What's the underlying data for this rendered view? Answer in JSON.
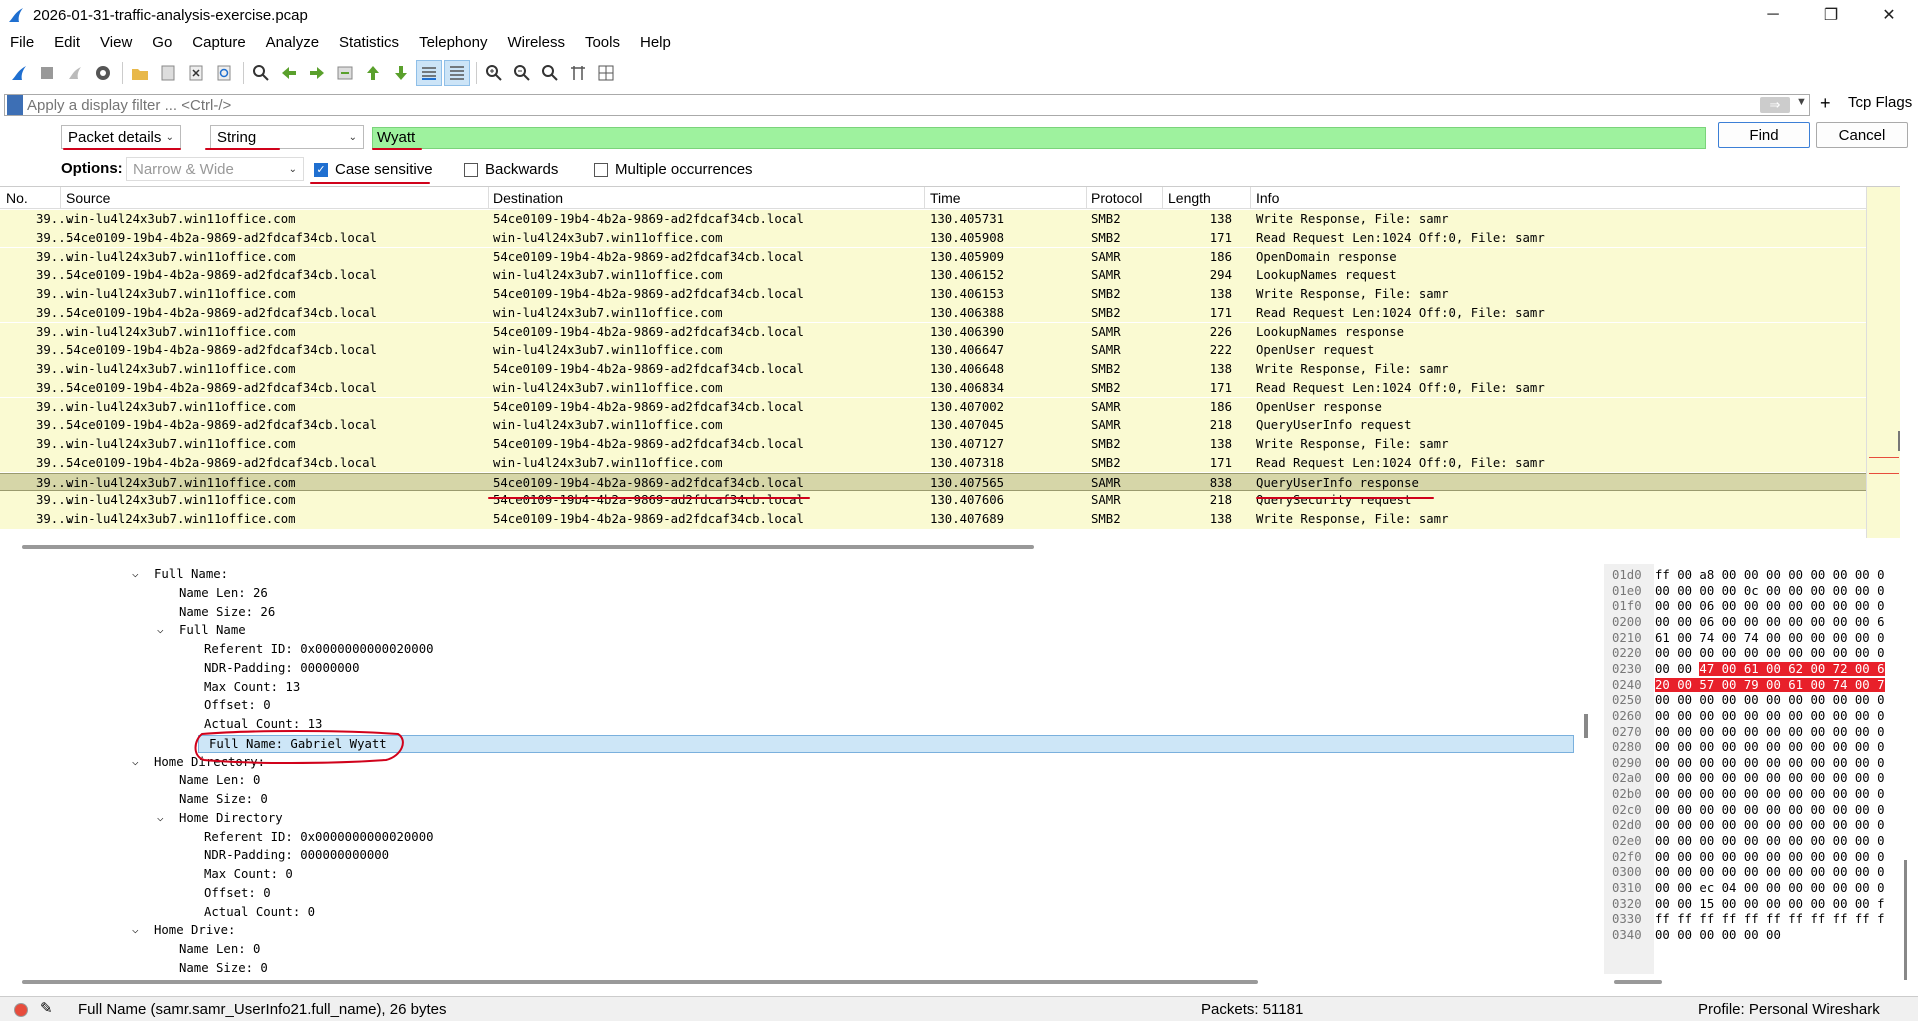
{
  "window": {
    "title": "2026-01-31-traffic-analysis-exercise.pcap",
    "minimize": "─",
    "maximize": "❐",
    "close": "✕"
  },
  "menu": [
    "File",
    "Edit",
    "View",
    "Go",
    "Capture",
    "Analyze",
    "Statistics",
    "Telephony",
    "Wireless",
    "Tools",
    "Help"
  ],
  "filter": {
    "placeholder": "Apply a display filter ... <Ctrl-/>",
    "apply_arrow": "⇒",
    "plus": "+",
    "tcp_flags": "Tcp Flags"
  },
  "find": {
    "search_in": "Packet details",
    "search_type": "String",
    "query": "Wyatt",
    "find_label": "Find",
    "cancel_label": "Cancel",
    "options_label": "Options:",
    "encoding": "Narrow & Wide",
    "case_sensitive_label": "Case sensitive",
    "case_sensitive_checked": true,
    "backwards_label": "Backwards",
    "multiple_label": "Multiple occurrences"
  },
  "packet_list": {
    "columns": [
      "No.",
      "Source",
      "Destination",
      "Time",
      "Protocol",
      "Length",
      "Info"
    ],
    "rows": [
      {
        "no": "39...",
        "source": "win-lu4l24x3ub7.win11office.com",
        "destination": "54ce0109-19b4-4b2a-9869-ad2fdcaf34cb.local",
        "time": "130.405731",
        "protocol": "SMB2",
        "length": "138",
        "info": "Write Response, File: samr"
      },
      {
        "no": "39...",
        "source": "54ce0109-19b4-4b2a-9869-ad2fdcaf34cb.local",
        "destination": "win-lu4l24x3ub7.win11office.com",
        "time": "130.405908",
        "protocol": "SMB2",
        "length": "171",
        "info": "Read Request Len:1024 Off:0, File: samr"
      },
      {
        "no": "39...",
        "source": "win-lu4l24x3ub7.win11office.com",
        "destination": "54ce0109-19b4-4b2a-9869-ad2fdcaf34cb.local",
        "time": "130.405909",
        "protocol": "SAMR",
        "length": "186",
        "info": "OpenDomain response"
      },
      {
        "no": "39...",
        "source": "54ce0109-19b4-4b2a-9869-ad2fdcaf34cb.local",
        "destination": "win-lu4l24x3ub7.win11office.com",
        "time": "130.406152",
        "protocol": "SAMR",
        "length": "294",
        "info": "LookupNames request"
      },
      {
        "no": "39...",
        "source": "win-lu4l24x3ub7.win11office.com",
        "destination": "54ce0109-19b4-4b2a-9869-ad2fdcaf34cb.local",
        "time": "130.406153",
        "protocol": "SMB2",
        "length": "138",
        "info": "Write Response, File: samr"
      },
      {
        "no": "39...",
        "source": "54ce0109-19b4-4b2a-9869-ad2fdcaf34cb.local",
        "destination": "win-lu4l24x3ub7.win11office.com",
        "time": "130.406388",
        "protocol": "SMB2",
        "length": "171",
        "info": "Read Request Len:1024 Off:0, File: samr"
      },
      {
        "no": "39...",
        "source": "win-lu4l24x3ub7.win11office.com",
        "destination": "54ce0109-19b4-4b2a-9869-ad2fdcaf34cb.local",
        "time": "130.406390",
        "protocol": "SAMR",
        "length": "226",
        "info": "LookupNames response"
      },
      {
        "no": "39...",
        "source": "54ce0109-19b4-4b2a-9869-ad2fdcaf34cb.local",
        "destination": "win-lu4l24x3ub7.win11office.com",
        "time": "130.406647",
        "protocol": "SAMR",
        "length": "222",
        "info": "OpenUser request"
      },
      {
        "no": "39...",
        "source": "win-lu4l24x3ub7.win11office.com",
        "destination": "54ce0109-19b4-4b2a-9869-ad2fdcaf34cb.local",
        "time": "130.406648",
        "protocol": "SMB2",
        "length": "138",
        "info": "Write Response, File: samr"
      },
      {
        "no": "39...",
        "source": "54ce0109-19b4-4b2a-9869-ad2fdcaf34cb.local",
        "destination": "win-lu4l24x3ub7.win11office.com",
        "time": "130.406834",
        "protocol": "SMB2",
        "length": "171",
        "info": "Read Request Len:1024 Off:0, File: samr"
      },
      {
        "no": "39...",
        "source": "win-lu4l24x3ub7.win11office.com",
        "destination": "54ce0109-19b4-4b2a-9869-ad2fdcaf34cb.local",
        "time": "130.407002",
        "protocol": "SAMR",
        "length": "186",
        "info": "OpenUser response"
      },
      {
        "no": "39...",
        "source": "54ce0109-19b4-4b2a-9869-ad2fdcaf34cb.local",
        "destination": "win-lu4l24x3ub7.win11office.com",
        "time": "130.407045",
        "protocol": "SAMR",
        "length": "218",
        "info": "QueryUserInfo request"
      },
      {
        "no": "39...",
        "source": "win-lu4l24x3ub7.win11office.com",
        "destination": "54ce0109-19b4-4b2a-9869-ad2fdcaf34cb.local",
        "time": "130.407127",
        "protocol": "SMB2",
        "length": "138",
        "info": "Write Response, File: samr"
      },
      {
        "no": "39...",
        "source": "54ce0109-19b4-4b2a-9869-ad2fdcaf34cb.local",
        "destination": "win-lu4l24x3ub7.win11office.com",
        "time": "130.407318",
        "protocol": "SMB2",
        "length": "171",
        "info": "Read Request Len:1024 Off:0, File: samr"
      },
      {
        "no": "39...",
        "source": "win-lu4l24x3ub7.win11office.com",
        "destination": "54ce0109-19b4-4b2a-9869-ad2fdcaf34cb.local",
        "time": "130.407565",
        "protocol": "SAMR",
        "length": "838",
        "info": "QueryUserInfo response",
        "selected": true
      },
      {
        "no": "39...",
        "source": "win-lu4l24x3ub7.win11office.com",
        "destination": "54ce0109-19b4-4b2a-9869-ad2fdcaf34cb.local",
        "time": "130.407606",
        "protocol": "SAMR",
        "length": "218",
        "info": "QuerySecurity request"
      },
      {
        "no": "39...",
        "source": "win-lu4l24x3ub7.win11office.com",
        "destination": "54ce0109-19b4-4b2a-9869-ad2fdcaf34cb.local",
        "time": "130.407689",
        "protocol": "SMB2",
        "length": "138",
        "info": "Write Response, File: samr"
      }
    ]
  },
  "details": [
    {
      "indent": 0,
      "arrow": "down",
      "text": "Full Name:"
    },
    {
      "indent": 1,
      "arrow": "",
      "text": "Name Len: 26"
    },
    {
      "indent": 1,
      "arrow": "",
      "text": "Name Size: 26"
    },
    {
      "indent": 1,
      "arrow": "down",
      "text": "Full Name"
    },
    {
      "indent": 2,
      "arrow": "",
      "text": "Referent ID: 0x0000000000020000"
    },
    {
      "indent": 2,
      "arrow": "",
      "text": "NDR-Padding: 00000000"
    },
    {
      "indent": 2,
      "arrow": "",
      "text": "Max Count: 13"
    },
    {
      "indent": 2,
      "arrow": "",
      "text": "Offset: 0"
    },
    {
      "indent": 2,
      "arrow": "",
      "text": "Actual Count: 13"
    },
    {
      "indent": 2,
      "arrow": "",
      "text": "Full Name: Gabriel Wyatt",
      "selected": true
    },
    {
      "indent": 0,
      "arrow": "down",
      "text": "Home Directory:"
    },
    {
      "indent": 1,
      "arrow": "",
      "text": "Name Len: 0"
    },
    {
      "indent": 1,
      "arrow": "",
      "text": "Name Size: 0"
    },
    {
      "indent": 1,
      "arrow": "down",
      "text": "Home Directory"
    },
    {
      "indent": 2,
      "arrow": "",
      "text": "Referent ID: 0x0000000000020000"
    },
    {
      "indent": 2,
      "arrow": "",
      "text": "NDR-Padding: 000000000000"
    },
    {
      "indent": 2,
      "arrow": "",
      "text": "Max Count: 0"
    },
    {
      "indent": 2,
      "arrow": "",
      "text": "Offset: 0"
    },
    {
      "indent": 2,
      "arrow": "",
      "text": "Actual Count: 0"
    },
    {
      "indent": 0,
      "arrow": "down",
      "text": "Home Drive:"
    },
    {
      "indent": 1,
      "arrow": "",
      "text": "Name Len: 0"
    },
    {
      "indent": 1,
      "arrow": "",
      "text": "Name Size: 0"
    }
  ],
  "hex": [
    {
      "offset": "01d0",
      "bytes": "ff 00 a8 00 00 00 00 00  00 00 0"
    },
    {
      "offset": "01e0",
      "bytes": "00 00 00 00 0c 00 00 00  00 00 0"
    },
    {
      "offset": "01f0",
      "bytes": "00 00 06 00 00 00 00 00  00 00 0"
    },
    {
      "offset": "0200",
      "bytes": "00 00 06 00 00 00 00 00  00 00 6"
    },
    {
      "offset": "0210",
      "bytes": "61 00 74 00 74 00 00 00  00 00 0"
    },
    {
      "offset": "0220",
      "bytes": "00 00 00 00 00 00 00 00  00 00 0"
    },
    {
      "offset": "0230",
      "bytes_plain": "00 00 ",
      "bytes_hl": "47 00 61 00 62 00  72 00 6"
    },
    {
      "offset": "0240",
      "bytes_plain": "",
      "bytes_hl": "20 00 57 00 79 00 61 00  74 00 7"
    },
    {
      "offset": "0250",
      "bytes": "00 00 00 00 00 00 00 00  00 00 0"
    },
    {
      "offset": "0260",
      "bytes": "00 00 00 00 00 00 00 00  00 00 0"
    },
    {
      "offset": "0270",
      "bytes": "00 00 00 00 00 00 00 00  00 00 0"
    },
    {
      "offset": "0280",
      "bytes": "00 00 00 00 00 00 00 00  00 00 0"
    },
    {
      "offset": "0290",
      "bytes": "00 00 00 00 00 00 00 00  00 00 0"
    },
    {
      "offset": "02a0",
      "bytes": "00 00 00 00 00 00 00 00  00 00 0"
    },
    {
      "offset": "02b0",
      "bytes": "00 00 00 00 00 00 00 00  00 00 0"
    },
    {
      "offset": "02c0",
      "bytes": "00 00 00 00 00 00 00 00  00 00 0"
    },
    {
      "offset": "02d0",
      "bytes": "00 00 00 00 00 00 00 00  00 00 0"
    },
    {
      "offset": "02e0",
      "bytes": "00 00 00 00 00 00 00 00  00 00 0"
    },
    {
      "offset": "02f0",
      "bytes": "00 00 00 00 00 00 00 00  00 00 0"
    },
    {
      "offset": "0300",
      "bytes": "00 00 00 00 00 00 00 00  00 00 0"
    },
    {
      "offset": "0310",
      "bytes": "00 00 ec 04 00 00 00 00  00 00 0"
    },
    {
      "offset": "0320",
      "bytes": "00 00 15 00 00 00 00 00  00 00 f"
    },
    {
      "offset": "0330",
      "bytes": "ff ff ff ff ff ff ff ff  ff ff f"
    },
    {
      "offset": "0340",
      "bytes": "00 00 00 00 00 00"
    }
  ],
  "status": {
    "field_info": "Full Name (samr.samr_UserInfo21.full_name), 26 bytes",
    "packets": "Packets: 51181",
    "profile": "Profile: Personal Wireshark Setup"
  },
  "colors": {
    "row_bg": "#fafad2",
    "selected_row_bg": "#d6d6a8",
    "find_match_bg": "#9ef29e",
    "hex_highlight": "#e8202a",
    "detail_selected_bg": "#cde6f7",
    "annotation_red": "#d0021b"
  }
}
